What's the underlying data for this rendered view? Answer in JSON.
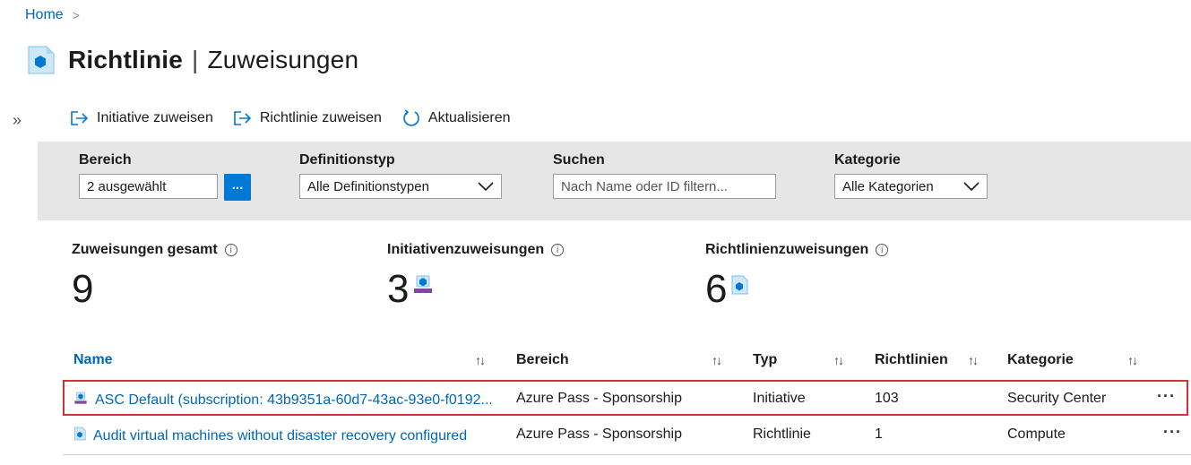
{
  "breadcrumb": {
    "home": "Home",
    "separator": ">"
  },
  "header": {
    "title_main": "Richtlinie",
    "title_sep": "|",
    "title_sub": "Zuweisungen",
    "icon": "policy-icon"
  },
  "collapse_glyph": "»",
  "toolbar": {
    "assign_initiative": "Initiative zuweisen",
    "assign_policy": "Richtlinie zuweisen",
    "refresh": "Aktualisieren"
  },
  "filters": {
    "scope": {
      "label": "Bereich",
      "value": "2 ausgewählt",
      "button": "..."
    },
    "definition_type": {
      "label": "Definitionstyp",
      "value": "Alle Definitionstypen"
    },
    "search": {
      "label": "Suchen",
      "placeholder": "Nach Name oder ID filtern..."
    },
    "category": {
      "label": "Kategorie",
      "value": "Alle Kategorien"
    }
  },
  "stats": {
    "total": {
      "label": "Zuweisungen gesamt",
      "value": "9"
    },
    "initiatives": {
      "label": "Initiativenzuweisungen",
      "value": "3"
    },
    "policies": {
      "label": "Richtlinienzuweisungen",
      "value": "6"
    },
    "info_glyph": "i"
  },
  "table": {
    "columns": [
      "Name",
      "Bereich",
      "Typ",
      "Richtlinien",
      "Kategorie"
    ],
    "sort_glyph": "↑↓",
    "rows": [
      {
        "name": "ASC Default (subscription: 43b9351a-60d7-43ac-93e0-f0192...",
        "scope": "Azure Pass - Sponsorship",
        "type": "Initiative",
        "policies": "103",
        "category": "Security Center",
        "icon": "initiative-icon",
        "more": "···"
      },
      {
        "name": "Audit virtual machines without disaster recovery configured",
        "scope": "Azure Pass - Sponsorship",
        "type": "Richtlinie",
        "policies": "1",
        "category": "Compute",
        "icon": "policy-icon",
        "more": "···"
      }
    ]
  },
  "colors": {
    "link": "#0067b8",
    "accent": "#0078d4",
    "highlight_border": "#d13438",
    "filter_bg": "#e6e6e6"
  }
}
